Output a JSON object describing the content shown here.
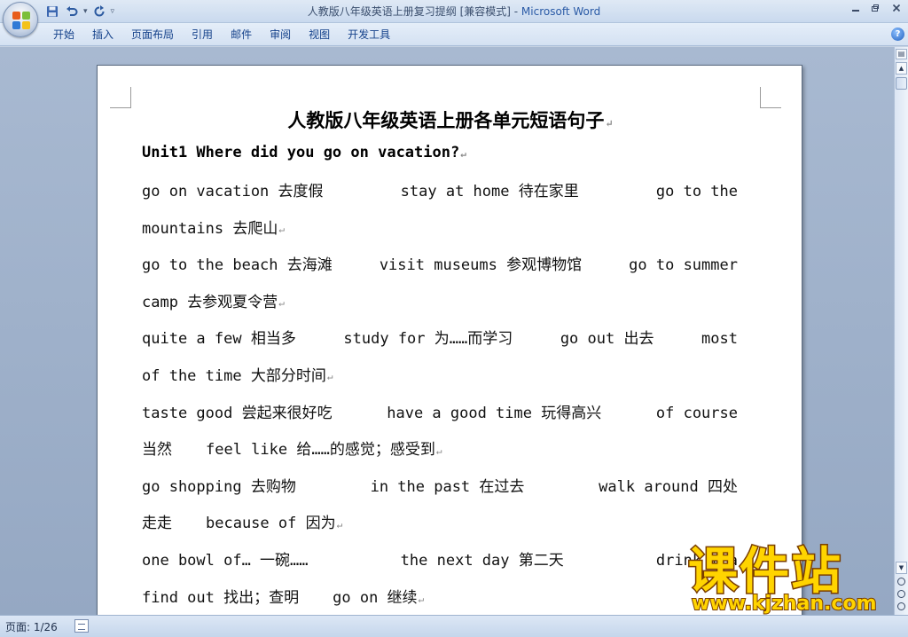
{
  "window": {
    "doc_title": "人教版八年级英语上册复习提纲 [兼容模式] - ",
    "app_name": "Microsoft Word"
  },
  "ribbon": {
    "tabs": [
      "开始",
      "插入",
      "页面布局",
      "引用",
      "邮件",
      "审阅",
      "视图",
      "开发工具"
    ]
  },
  "document": {
    "title": "人教版八年级英语上册各单元短语句子",
    "unit_heading": "Unit1 Where did you go on vacation?",
    "lines": [
      [
        "go on vacation 去度假",
        "stay at home 待在家里",
        "go to the"
      ],
      [
        "mountains 去爬山"
      ],
      [
        "go to the beach 去海滩",
        "visit museums 参观博物馆",
        "go to summer"
      ],
      [
        "camp 去参观夏令营"
      ],
      [
        "quite a few 相当多",
        "study for 为……而学习",
        "go out 出去",
        "most"
      ],
      [
        "of the time 大部分时间"
      ],
      [
        "taste good 尝起来很好吃",
        "have a good time 玩得高兴",
        "of course"
      ],
      [
        "当然",
        "feel like 给……的感觉；感受到"
      ],
      [
        "go shopping 去购物",
        "in the past 在过去",
        "walk around 四处"
      ],
      [
        "走走",
        "because of 因为"
      ],
      [
        "one bowl of… 一碗……",
        "the next day 第二天",
        "drink tea"
      ],
      [
        "find out 找出；查明",
        "go on 继续"
      ]
    ]
  },
  "status": {
    "page_info": "页面: 1/26"
  },
  "watermark": {
    "main": "课件站",
    "url": "www.kjzhan.com"
  },
  "colors": {
    "ribbon_text": "#15428b",
    "workspace": "#9dafc8",
    "watermark_fill": "#ffd400"
  }
}
